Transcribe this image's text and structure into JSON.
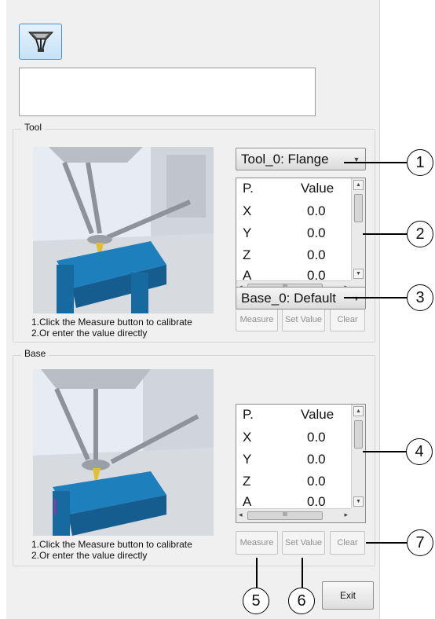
{
  "toolbar": {
    "icon": "delta-robot-icon"
  },
  "tool_section": {
    "legend": "Tool",
    "selected": "Tool_0: Flange",
    "table": {
      "headers": [
        "P.",
        "Value"
      ],
      "rows": [
        {
          "p": "X",
          "v": "0.0"
        },
        {
          "p": "Y",
          "v": "0.0"
        },
        {
          "p": "Z",
          "v": "0.0"
        },
        {
          "p": "A",
          "v": "0.0"
        }
      ]
    },
    "buttons": {
      "measure": "Measure",
      "set_value": "Set Value",
      "clear": "Clear"
    },
    "instructions": [
      "1.Click the Measure button to calibrate",
      "2.Or enter the value directly"
    ]
  },
  "base_section": {
    "legend": "Base",
    "selected": "Base_0: Default",
    "table": {
      "headers": [
        "P.",
        "Value"
      ],
      "rows": [
        {
          "p": "X",
          "v": "0.0"
        },
        {
          "p": "Y",
          "v": "0.0"
        },
        {
          "p": "Z",
          "v": "0.0"
        },
        {
          "p": "A",
          "v": "0.0"
        }
      ]
    },
    "buttons": {
      "measure": "Measure",
      "set_value": "Set Value",
      "clear": "Clear"
    },
    "instructions": [
      "1.Click the Measure button to calibrate",
      "2.Or enter the value directly"
    ]
  },
  "exit_label": "Exit",
  "callouts": [
    "1",
    "2",
    "3",
    "4",
    "5",
    "6",
    "7"
  ],
  "scrollbar": {
    "thumb_grip": "III"
  }
}
